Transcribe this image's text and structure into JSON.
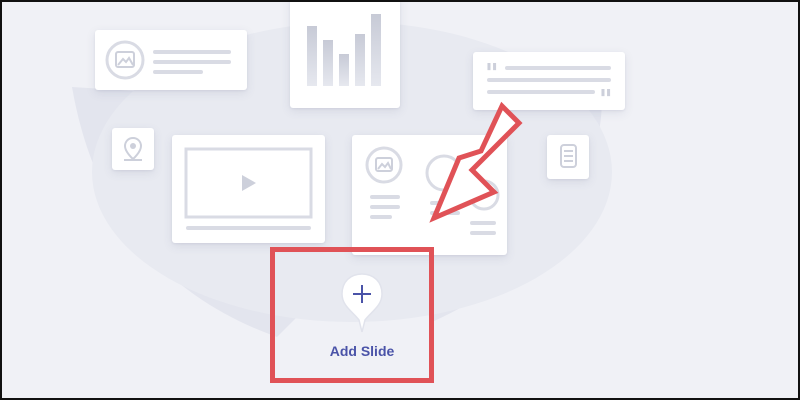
{
  "canvas": {
    "background_color": "#f0f1f6",
    "card_color": "#ffffff",
    "placeholder_color": "#d9dbe4"
  },
  "add_slide": {
    "label": "Add Slide",
    "icon": "plus-icon",
    "accent_color": "#4a53a8"
  },
  "annotation": {
    "highlight_color": "#e05257",
    "arrow_icon": "red-arrow-icon"
  },
  "slide_templates": [
    {
      "name": "image-text-card",
      "icon": "image-icon"
    },
    {
      "name": "chart-card",
      "icon": "bar-chart-icon"
    },
    {
      "name": "quote-card",
      "icon": "quote-icon"
    },
    {
      "name": "location-card",
      "icon": "map-pin-icon"
    },
    {
      "name": "video-card",
      "icon": "play-icon"
    },
    {
      "name": "gallery-card",
      "icon": "image-icon"
    },
    {
      "name": "document-card",
      "icon": "document-icon"
    }
  ]
}
